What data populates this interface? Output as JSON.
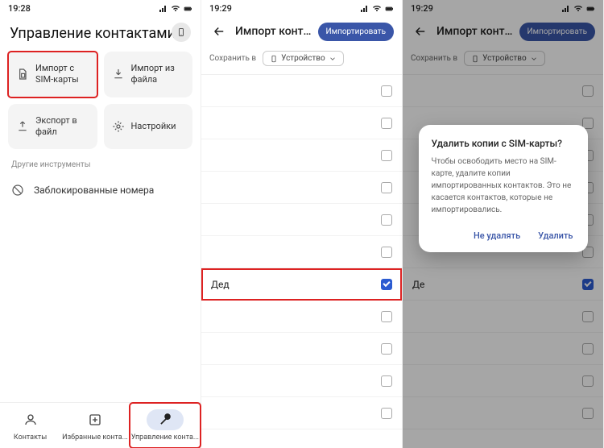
{
  "status": {
    "time1": "19:28",
    "time2": "19:29",
    "time3": "19:29"
  },
  "p1": {
    "title": "Управление контактами",
    "cards": {
      "sim": "Импорт с\nSIM-карты",
      "file": "Импорт из\nфайла",
      "export": "Экспорт в файл",
      "settings": "Настройки"
    },
    "otherHeading": "Другие инструменты",
    "blocked": "Заблокированные номера",
    "nav": {
      "contacts": "Контакты",
      "highlights": "Избранные конта...",
      "manage": "Управление конта..."
    }
  },
  "p2": {
    "title": "Импорт контак...",
    "importBtn": "Импортировать",
    "saveLabel": "Сохранить в",
    "chipDevice": "Устройство",
    "rows": [
      {
        "name": "",
        "checked": false
      },
      {
        "name": "",
        "checked": false
      },
      {
        "name": "",
        "checked": false
      },
      {
        "name": "",
        "checked": false
      },
      {
        "name": "",
        "checked": false
      },
      {
        "name": "",
        "checked": false
      },
      {
        "name": "Дед",
        "checked": true,
        "highlight": true
      },
      {
        "name": "",
        "checked": false
      },
      {
        "name": "",
        "checked": false
      },
      {
        "name": "",
        "checked": false
      },
      {
        "name": "",
        "checked": false
      }
    ]
  },
  "p3": {
    "title": "Импорт контак...",
    "importBtn": "Импортировать",
    "saveLabel": "Сохранить в",
    "chipDevice": "Устройство",
    "rows": [
      {
        "name": "",
        "checked": false
      },
      {
        "name": "",
        "checked": false
      },
      {
        "name": "",
        "checked": false
      },
      {
        "name": "",
        "checked": false
      },
      {
        "name": "",
        "checked": false
      },
      {
        "name": "",
        "checked": false
      },
      {
        "name": "Де",
        "checked": true
      },
      {
        "name": "",
        "checked": false
      },
      {
        "name": "",
        "checked": false
      },
      {
        "name": "",
        "checked": false
      },
      {
        "name": "",
        "checked": false
      }
    ],
    "dialog": {
      "title": "Удалить копии с SIM-карты?",
      "body": "Чтобы освободить место на SIM-карте, удалите копии импортированных контактов. Это не касается контактов, которые не импортировались.",
      "cancel": "Не удалять",
      "confirm": "Удалить"
    }
  }
}
